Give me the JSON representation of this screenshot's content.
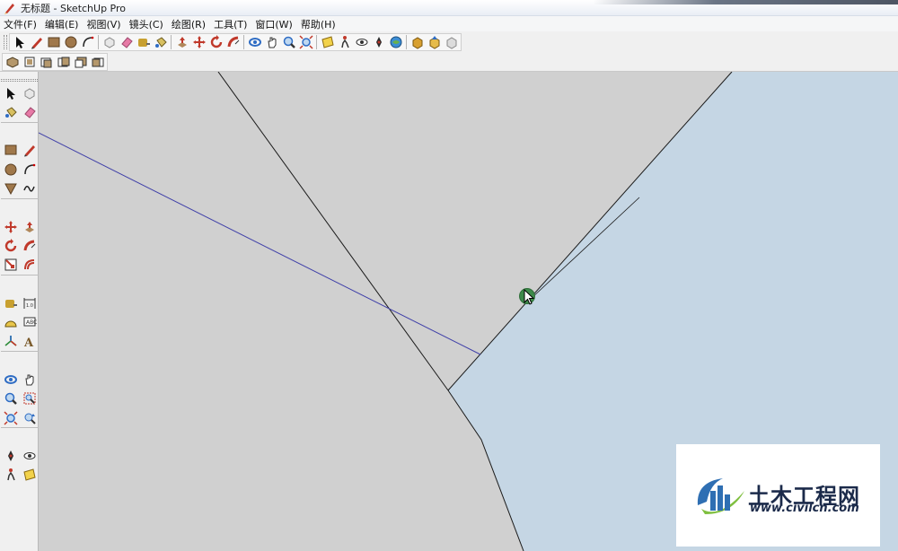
{
  "window": {
    "title": "无标题 - SketchUp Pro"
  },
  "menu": [
    "文件(F)",
    "编辑(E)",
    "视图(V)",
    "镜头(C)",
    "绘图(R)",
    "工具(T)",
    "窗口(W)",
    "帮助(H)"
  ],
  "toolbar_main": [
    [
      "select-icon",
      "pencil-icon",
      "rectangle-icon",
      "circle-icon",
      "arc-icon"
    ],
    [
      "make-component-icon",
      "eraser-icon",
      "tape-measure-icon",
      "paint-bucket-icon"
    ],
    [
      "push-pull-icon",
      "move-icon",
      "rotate-icon",
      "follow-me-icon"
    ],
    [
      "orbit-icon",
      "pan-icon",
      "zoom-icon",
      "zoom-extents-icon"
    ],
    [
      "section-plane-icon",
      "walk-icon",
      "look-around-icon",
      "position-camera-icon",
      "geo-location-icon"
    ],
    [
      "3d-warehouse-get-icon",
      "3d-warehouse-share-icon",
      "extension-warehouse-icon"
    ]
  ],
  "toolbar_views": [
    "iso-view-icon",
    "top-view-icon",
    "front-view-icon",
    "right-view-icon",
    "back-view-icon",
    "left-view-icon"
  ],
  "toolbar_left": [
    [
      "select-icon",
      "make-component-icon"
    ],
    [
      "paint-bucket-icon",
      "eraser-icon"
    ],
    "sep",
    [
      "rectangle-icon",
      "pencil-icon"
    ],
    [
      "circle-icon",
      "arc-icon"
    ],
    [
      "polygon-icon",
      "freehand-icon"
    ],
    "sep",
    [
      "move-icon",
      "push-pull-icon"
    ],
    [
      "rotate-icon",
      "follow-me-icon"
    ],
    [
      "scale-icon",
      "offset-icon"
    ],
    "sep",
    [
      "tape-measure-icon",
      "dimension-icon"
    ],
    [
      "protractor-icon",
      "text-icon"
    ],
    [
      "axes-icon",
      "3d-text-icon"
    ],
    "sep",
    [
      "orbit-icon",
      "pan-icon"
    ],
    [
      "zoom-icon",
      "zoom-window-icon"
    ],
    [
      "zoom-extents-icon",
      "previous-view-icon"
    ],
    "sep",
    [
      "position-camera-icon",
      "look-around-icon"
    ],
    [
      "walk-icon",
      "section-plane-icon"
    ]
  ],
  "colors": {
    "ground": "#d0d0d0",
    "sky": "#c5d6e4",
    "axis_blue": "#4040a8",
    "edge": "#1a1a1a",
    "inference": "#3d8a4a"
  },
  "watermark": {
    "cn": "土木工程网",
    "url": "www.civilcn.com"
  }
}
